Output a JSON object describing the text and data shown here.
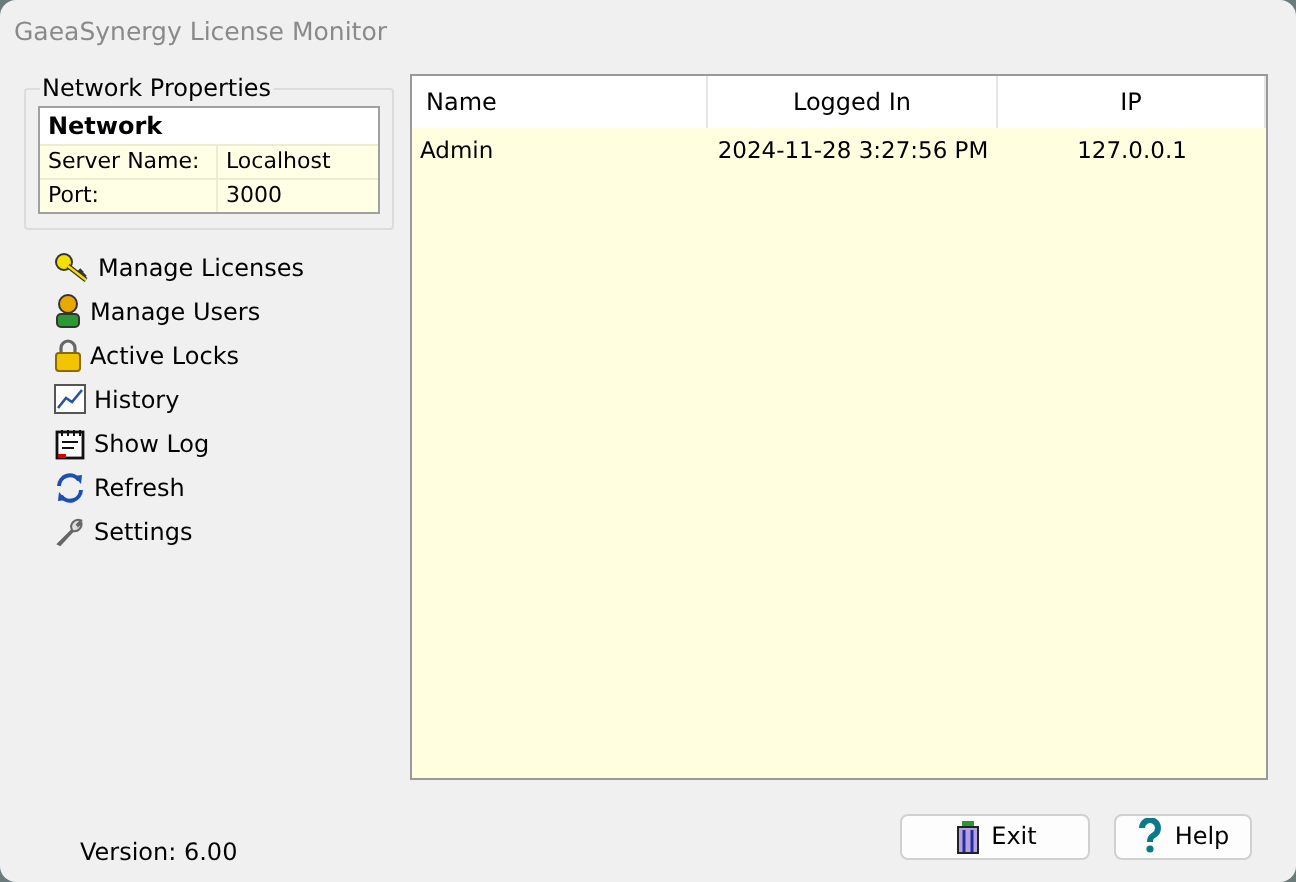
{
  "window": {
    "title": "GaeaSynergy License Monitor"
  },
  "network_properties": {
    "title": "Network Properties",
    "heading": "Network",
    "rows": [
      {
        "label": "Server Name:",
        "value": "Localhost"
      },
      {
        "label": "Port:",
        "value": "3000"
      }
    ]
  },
  "actions": [
    {
      "kind": "key",
      "label": "Manage Licenses"
    },
    {
      "kind": "user",
      "label": "Manage Users"
    },
    {
      "kind": "lock",
      "label": "Active Locks"
    },
    {
      "kind": "chart",
      "label": "History"
    },
    {
      "kind": "log",
      "label": "Show Log"
    },
    {
      "kind": "refresh",
      "label": "Refresh"
    },
    {
      "kind": "wrench",
      "label": "Settings"
    }
  ],
  "table": {
    "columns": [
      "Name",
      "Logged In",
      "IP"
    ],
    "rows": [
      [
        "Admin",
        "2024-11-28 3:27:56 PM",
        "127.0.0.1"
      ]
    ]
  },
  "version": "Version: 6.00",
  "buttons": [
    {
      "kind": "exit",
      "label": "Exit"
    },
    {
      "kind": "help",
      "label": "Help"
    }
  ]
}
